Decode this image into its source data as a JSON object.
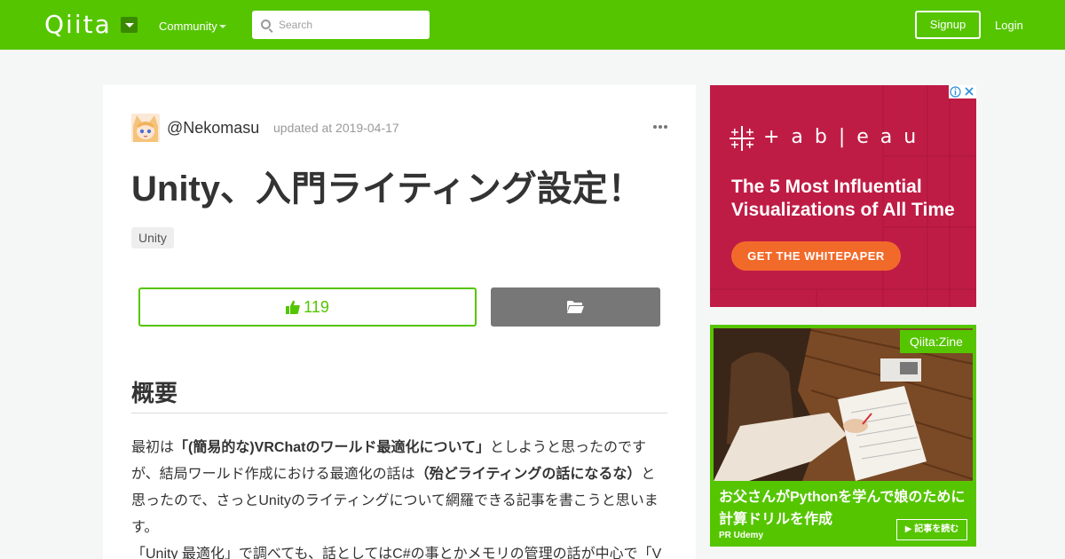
{
  "header": {
    "logo": "Qiita",
    "community": "Community",
    "search_placeholder": "Search",
    "signup": "Signup",
    "login": "Login"
  },
  "article": {
    "author": "@Nekomasu",
    "updated": "updated at 2019-04-17",
    "title": "Unity、入門ライティング設定！",
    "tag": "Unity",
    "like_count": "119",
    "section_heading": "概要",
    "paragraph_line1_a": "最初は",
    "paragraph_line1_bold": "「(簡易的な)VRChatのワールド最適化について」",
    "paragraph_line1_b": "としようと思ったのです",
    "paragraph_line2_a": "が、結局ワールド作成における最適化の話は",
    "paragraph_line2_bold": "（殆どライティングの話になるな）",
    "paragraph_line2_b": "と",
    "paragraph_line3": "思ったので、さっとUnityのライティングについて網羅できる記事を書こうと思いま",
    "paragraph_line4": "す。",
    "paragraph_line5": "「Unity 最適化」で調べても、話としてはC#の事とかメモリの管理の話が中心で「V"
  },
  "ads": {
    "tableau": {
      "brand": "+ a b | e a u",
      "headline": "The 5 Most Influential Visualizations of All Time",
      "cta": "GET THE WHITEPAPER"
    },
    "qiita_zine": {
      "brand": "Qiita:Zine",
      "headline": "お父さんがPythonを学んで娘のために計算ドリルを作成",
      "sponsor": "PR Udemy",
      "button": "▶ 記事を読む"
    }
  },
  "colors": {
    "brand_green": "#55c500",
    "tableau_red": "#bf1c45",
    "cta_orange": "#f26a2a"
  }
}
